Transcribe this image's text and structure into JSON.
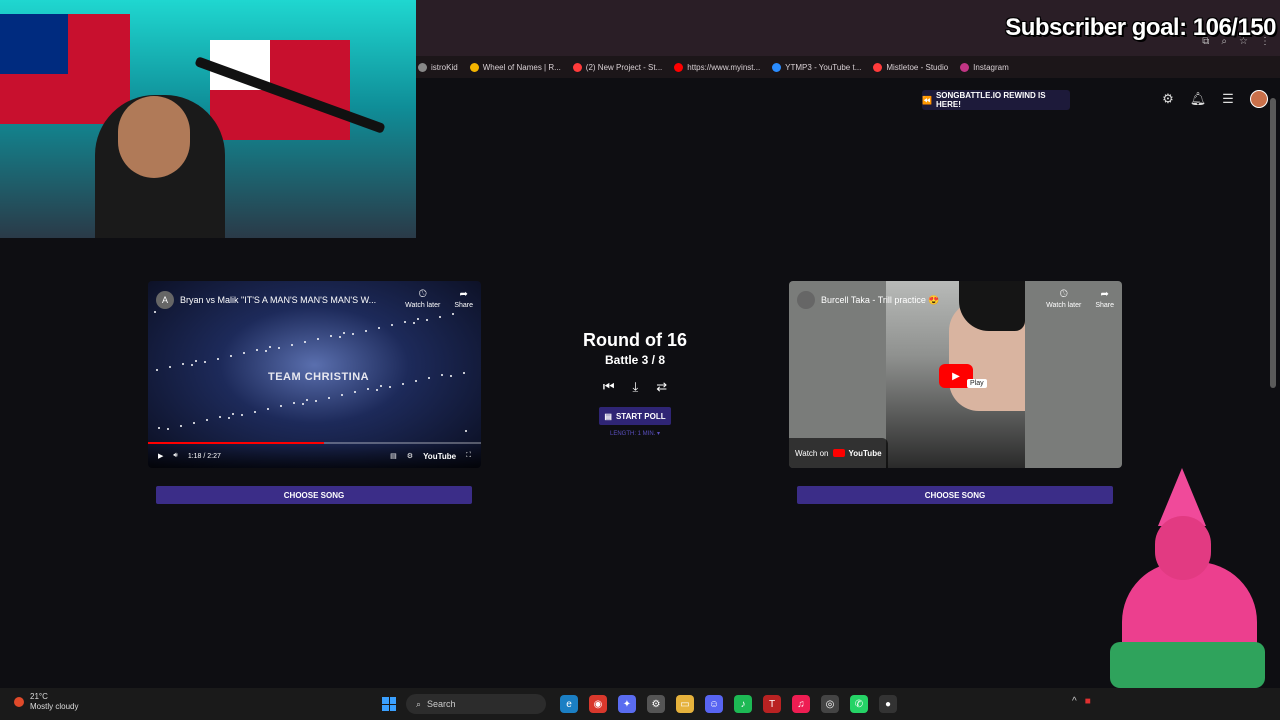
{
  "overlay": {
    "subscriber_goal": "Subscriber goal: 106/150"
  },
  "bookmarks": [
    {
      "label": "istroKid",
      "color": "#888888"
    },
    {
      "label": "Wheel of Names | R...",
      "color": "#f4b400"
    },
    {
      "label": "(2) New Project - St...",
      "color": "#ff3b3b"
    },
    {
      "label": "https://www.myinst...",
      "color": "#ff0000"
    },
    {
      "label": "YTMP3 - YouTube t...",
      "color": "#2a8cff"
    },
    {
      "label": "Mistletoe - Studio",
      "color": "#ff3b3b"
    },
    {
      "label": "Instagram",
      "color": "#c13584"
    }
  ],
  "header": {
    "rewind_banner": "SONGBATTLE.IO REWIND IS HERE!"
  },
  "video_left": {
    "channel_initial": "A",
    "title": "Bryan vs Malik \"IT'S A MAN'S MAN'S MAN'S W...",
    "watch_later": "Watch later",
    "share": "Share",
    "stage_text": "TEAM CHRISTINA",
    "time": "1:18 / 2:27",
    "progress": 0.53,
    "brand": "YouTube"
  },
  "video_right": {
    "title": "Burcell Taka - Trill practice 😍",
    "watch_later": "Watch later",
    "share": "Share",
    "play_tooltip": "Play",
    "watch_on": "Watch on",
    "brand": "YouTube"
  },
  "choose_song_label": "CHOOSE SONG",
  "round": {
    "title": "Round of 16",
    "battle": "Battle 3 / 8",
    "start_poll": "START POLL",
    "length": "LENGTH: 1 MIN. ▾"
  },
  "taskbar": {
    "temperature": "21°C",
    "weather": "Mostly cloudy",
    "search_placeholder": "Search"
  }
}
